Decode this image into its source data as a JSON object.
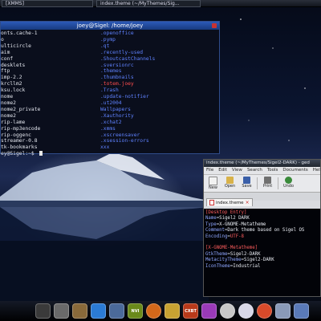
{
  "top_panel": {
    "tabs": [
      {
        "label": "[XMMS]"
      },
      {
        "label": "index.theme (~/MyThemes/Sig..."
      }
    ]
  },
  "terminal": {
    "title": "joey@Sigel: /home/joey",
    "col1": [
      "onts.cache-1",
      "o",
      "ulticircle",
      "aim",
      "conf",
      "desklets",
      "ftp",
      "imp-2.2",
      "krcllm2",
      "ksu.lock",
      "nome",
      "nome2",
      "nome2_private",
      "nome2",
      "rip-lame",
      "rip-mp3encode",
      "rip-oggenc",
      "streamer-0.8",
      "tk-bookmarks",
      "ey@Sigel:~$ "
    ],
    "col2": [
      ".openoffice",
      ".pymp",
      ".qt",
      ".recently-used",
      ".ShoutcastChannels",
      ".sversionrc",
      ".themes",
      ".thumbnails",
      ".totem.joey",
      ".Trash",
      ".update-notifier",
      ".ut2004",
      "Wallpapers",
      ".Xauthority",
      ".xchat2",
      ".xmms",
      ".xscreensaver",
      ".xsession-errors",
      "xxx"
    ],
    "highlighted_col2_index": 8
  },
  "editor": {
    "title": "index.theme (~/MyThemes/Sigel2-DARK) - ged",
    "menu": [
      "File",
      "Edit",
      "View",
      "Search",
      "Tools",
      "Documents",
      "Help"
    ],
    "toolbar": [
      {
        "label": "New",
        "icon": "new-document-icon",
        "color": "#f2f2f2"
      },
      {
        "label": "Open",
        "icon": "open-folder-icon",
        "color": "#d8b24a"
      },
      {
        "label": "Save",
        "icon": "save-icon",
        "color": "#3a5fa8"
      },
      {
        "label": "Print",
        "icon": "print-icon",
        "color": "#707070"
      },
      {
        "label": "Undo",
        "icon": "undo-icon",
        "color": "#3a8a3a"
      }
    ],
    "tab_label": "index.theme",
    "lines": [
      {
        "type": "section",
        "text": "[Desktop Entry]"
      },
      {
        "type": "kv",
        "key": "Name",
        "value": "Sigel2 DARK"
      },
      {
        "type": "kv",
        "key": "Type",
        "value": "X-GNOME-Metatheme"
      },
      {
        "type": "kv",
        "key": "Comment",
        "value": "Dark theme based on Sigel OS"
      },
      {
        "type": "kv",
        "key": "Encoding",
        "value": "UTF-8",
        "red": true
      },
      {
        "type": "blank",
        "text": ""
      },
      {
        "type": "section",
        "text": "[X-GNOME-Metatheme]"
      },
      {
        "type": "kv",
        "key": "GtkTheme",
        "value": "Sigel2-DARK"
      },
      {
        "type": "kv",
        "key": "MetacityTheme",
        "value": "Sigel2-DARK"
      },
      {
        "type": "kv",
        "key": "IconTheme",
        "value": "Industrial"
      }
    ]
  },
  "dock": {
    "icons": [
      {
        "name": "terminal-icon",
        "label": "",
        "color": "#3a3a3a"
      },
      {
        "name": "file-manager-icon",
        "label": "",
        "color": "#6a6a6a"
      },
      {
        "name": "notes-icon",
        "label": "",
        "color": "#8a6a3a"
      },
      {
        "name": "package-icon",
        "label": "",
        "color": "#2b7bd4"
      },
      {
        "name": "network-icon",
        "label": "",
        "color": "#4b6a9a"
      },
      {
        "name": "nvidia-icon",
        "label": "NVI",
        "color": "#6a8a1a"
      },
      {
        "name": "firefox-icon",
        "label": "",
        "color": "#d4681a",
        "round": true
      },
      {
        "name": "tools-icon",
        "label": "",
        "color": "#c8a232"
      },
      {
        "name": "crossover-icon",
        "label": "CXBT",
        "color": "#b83a1a"
      },
      {
        "name": "butterfly-icon",
        "label": "",
        "color": "#9a3ab8"
      },
      {
        "name": "music-player-icon",
        "label": "",
        "color": "#c8c8c8",
        "round": true
      },
      {
        "name": "cd-icon",
        "label": "",
        "color": "#d8d8e8",
        "round": true
      },
      {
        "name": "media-icon",
        "label": "",
        "color": "#d84a2a",
        "round": true
      },
      {
        "name": "chat-icon",
        "label": "",
        "color": "#8a9ab8"
      },
      {
        "name": "user-icon",
        "label": "",
        "color": "#5a7ab8"
      }
    ]
  }
}
